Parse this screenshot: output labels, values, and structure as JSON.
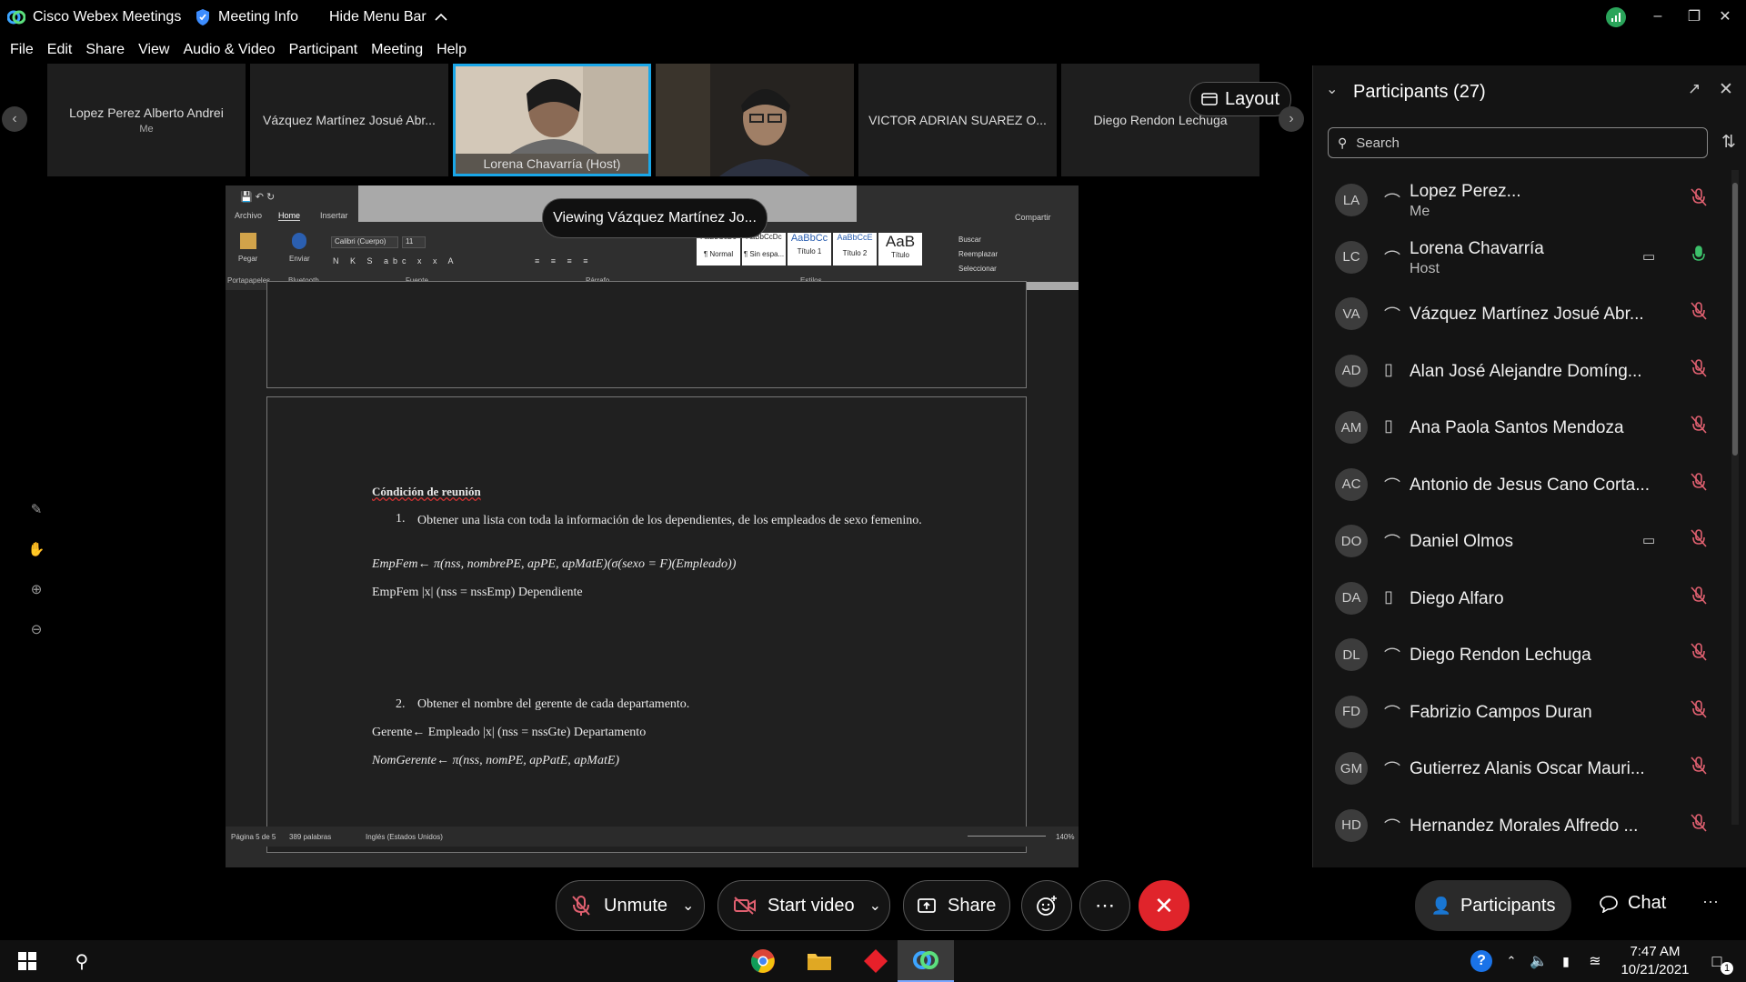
{
  "titlebar": {
    "app_title": "Cisco Webex Meetings",
    "meeting_info": "Meeting Info",
    "hide_menu": "Hide Menu Bar"
  },
  "menu": [
    "File",
    "Edit",
    "Share",
    "View",
    "Audio & Video",
    "Participant",
    "Meeting",
    "Help"
  ],
  "filmstrip": {
    "tiles": [
      {
        "name": "Lopez Perez Alberto Andrei",
        "sub": "Me"
      },
      {
        "name": "Vázquez Martínez Josué Abr..."
      },
      {
        "name": "Lorena Chavarría  (Host)"
      },
      {
        "name": ""
      },
      {
        "name": "VICTOR ADRIAN SUAREZ O..."
      },
      {
        "name": "Diego Rendon Lechuga"
      }
    ],
    "layout_label": "Layout"
  },
  "share": {
    "viewing_label": "Viewing Vázquez Martínez Jo...",
    "ribbon": {
      "tabs": [
        "Archivo",
        "Home",
        "Insertar"
      ],
      "compartir": "Compartir",
      "paste": "Pegar",
      "send": "Enviar",
      "font": "Calibri (Cuerpo)",
      "font_size": "11",
      "groups": [
        "Portapapeles",
        "Bluetooth",
        "Fuente",
        "Párrafo",
        "Estilos"
      ],
      "styles": [
        "¶ Normal",
        "¶ Sin espa...",
        "Título 1",
        "Título 2",
        "Título"
      ],
      "style_samples": [
        "AaBbCcDc",
        "AaBbCcDc",
        "AaBbCc",
        "AaBbCcE",
        "AaB"
      ],
      "edit": [
        "Buscar",
        "Reemplazar",
        "Seleccionar"
      ]
    },
    "doc": {
      "heading": "Cóndición de reunión",
      "item1_num": "1.",
      "item1": "Obtener una lista con toda la información de los dependientes, de los empleados de sexo femenino.",
      "line1": "EmpFem← π(nss, nombrePE, apPE, apMatE)(σ(sexo = F)(Empleado))",
      "line2": "EmpFem |x| (nss = nssEmp) Dependiente",
      "item2_num": "2.",
      "item2": "Obtener el nombre del gerente de cada departamento.",
      "line3": "Gerente← Empleado |x| (nss = nssGte) Departamento",
      "line4": "NomGerente← π(nss, nomPE, apPatE, apMatE)"
    },
    "status": {
      "page": "Página 5 de 5",
      "words": "389 palabras",
      "lang": "Inglés (Estados Unidos)",
      "zoom": "140%"
    }
  },
  "panel": {
    "title": "Participants (27)",
    "search_placeholder": "Search",
    "participants": [
      {
        "initials": "LA",
        "name": "Lopez Perez...",
        "role": "Me",
        "device": "headset",
        "muted": true
      },
      {
        "initials": "LC",
        "name": "Lorena Chavarría",
        "role": "Host",
        "device": "headset",
        "muted": false,
        "video": true
      },
      {
        "initials": "VA",
        "name": "Vázquez Martínez Josué Abr...",
        "role": "",
        "device": "headset",
        "muted": true
      },
      {
        "initials": "AD",
        "name": "Alan José Alejandre Domíng...",
        "role": "",
        "device": "phone",
        "muted": true
      },
      {
        "initials": "AM",
        "name": "Ana Paola Santos Mendoza",
        "role": "",
        "device": "phone",
        "muted": true
      },
      {
        "initials": "AC",
        "name": "Antonio de Jesus Cano Corta...",
        "role": "",
        "device": "headset",
        "muted": true
      },
      {
        "initials": "DO",
        "name": "Daniel Olmos",
        "role": "",
        "device": "headset",
        "muted": true,
        "video": true
      },
      {
        "initials": "DA",
        "name": "Diego Alfaro",
        "role": "",
        "device": "phone",
        "muted": true
      },
      {
        "initials": "DL",
        "name": "Diego Rendon Lechuga",
        "role": "",
        "device": "headset",
        "muted": true
      },
      {
        "initials": "FD",
        "name": "Fabrizio Campos Duran",
        "role": "",
        "device": "headset",
        "muted": true
      },
      {
        "initials": "GM",
        "name": "Gutierrez Alanis Oscar Mauri...",
        "role": "",
        "device": "headset",
        "muted": true
      },
      {
        "initials": "HD",
        "name": "Hernandez Morales Alfredo ...",
        "role": "",
        "device": "headset",
        "muted": true
      }
    ]
  },
  "controls": {
    "unmute": "Unmute",
    "start_video": "Start video",
    "share": "Share",
    "participants": "Participants",
    "chat": "Chat"
  },
  "taskbar": {
    "time": "7:47 AM",
    "date": "10/21/2021",
    "notifications": "1"
  },
  "colors": {
    "accent_blue": "#1aa7e8",
    "end_red": "#e0242b",
    "mute_red": "#e06070",
    "unmuted_green": "#3cc06a"
  }
}
